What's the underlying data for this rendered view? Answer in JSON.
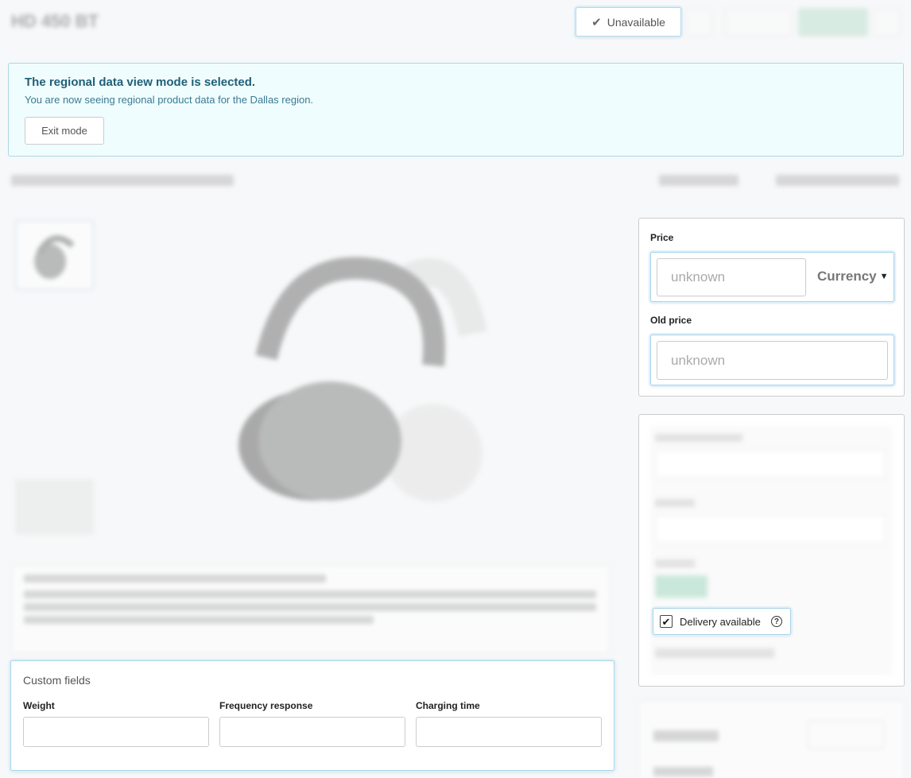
{
  "header": {
    "product_title": "HD 450 BT",
    "status_label": "Unavailable"
  },
  "notice": {
    "title": "The regional data view mode is selected.",
    "text": "You are now seeing regional product data for the Dallas region.",
    "exit_label": "Exit mode"
  },
  "link_row": {
    "url": "https://...",
    "preview": "Preview",
    "code": "..."
  },
  "pricing": {
    "price_label": "Price",
    "price_placeholder": "unknown",
    "currency_label": "Currency",
    "old_price_label": "Old price",
    "old_price_placeholder": "unknown"
  },
  "options": {
    "delivery_label": "Delivery available",
    "delivery_checked": true
  },
  "custom_fields": {
    "title": "Custom fields",
    "fields": [
      {
        "label": "Weight",
        "value": ""
      },
      {
        "label": "Frequency response",
        "value": ""
      },
      {
        "label": "Charging time",
        "value": ""
      }
    ]
  }
}
